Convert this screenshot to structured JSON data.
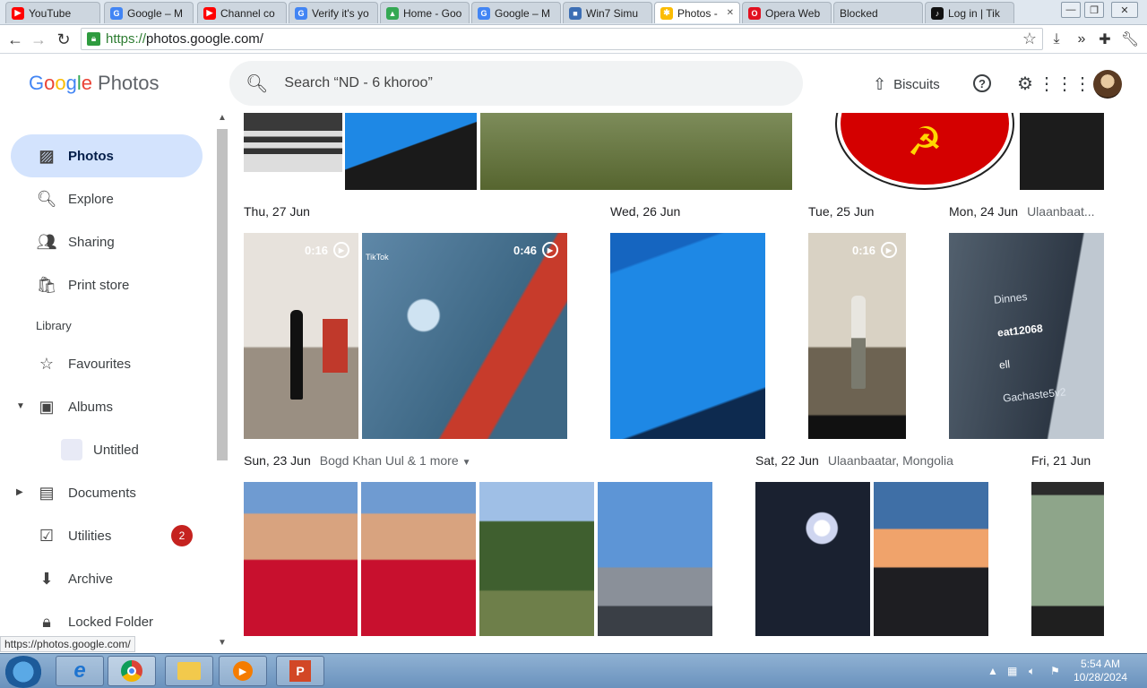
{
  "browser": {
    "tabs": [
      {
        "title": "YouTube",
        "icon_color": "#ff0000",
        "icon": "▶"
      },
      {
        "title": "Google – M",
        "icon_color": "#4285f4",
        "icon": "G"
      },
      {
        "title": "Channel co",
        "icon_color": "#ff0000",
        "icon": "▶"
      },
      {
        "title": "Verify it's yo",
        "icon_color": "#4285f4",
        "icon": "G"
      },
      {
        "title": "Home - Goo",
        "icon_color": "#34a853",
        "icon": "▲"
      },
      {
        "title": "Google – M",
        "icon_color": "#4285f4",
        "icon": "G"
      },
      {
        "title": "Win7 Simu",
        "icon_color": "#3c6eb4",
        "icon": "■"
      },
      {
        "title": "Photos - ",
        "icon_color": "#fbbc04",
        "icon": "✱"
      },
      {
        "title": "Opera Web",
        "icon_color": "#e21020",
        "icon": "O"
      },
      {
        "title": "Blocked",
        "icon_color": "#dfe7ef",
        "icon": ""
      },
      {
        "title": "Log in | Tik",
        "icon_color": "#111111",
        "icon": "♪"
      }
    ],
    "url_scheme": "https://",
    "url_host": "photos.google.com/",
    "status_url": "https://photos.google.com/"
  },
  "app": {
    "logo_text": "Photos",
    "search_placeholder": "Search “ND - 6 khoroo”",
    "upload_label": "Biscuits",
    "nav": {
      "photos": "Photos",
      "explore": "Explore",
      "sharing": "Sharing",
      "print_store": "Print store",
      "library_heading": "Library",
      "favourites": "Favourites",
      "albums": "Albums",
      "untitled": "Untitled",
      "documents": "Documents",
      "utilities": "Utilities",
      "utilities_badge": "2",
      "archive": "Archive",
      "locked_folder": "Locked Folder"
    },
    "dates": {
      "d27": "Thu, 27 Jun",
      "d26": "Wed, 26 Jun",
      "d25": "Tue, 25 Jun",
      "d24": "Mon, 24 Jun",
      "d24_loc": "Ulaanbaat...",
      "d23": "Sun, 23 Jun",
      "d23_loc": "Bogd Khan Uul & 1 more",
      "d22": "Sat, 22 Jun",
      "d22_loc": "Ulaanbaatar, Mongolia",
      "d21": "Fri, 21 Jun"
    },
    "videos": {
      "v1": "0:16",
      "v2": "0:46",
      "v3": "0:16"
    },
    "photo_text": {
      "tiktok": "TikTok",
      "menu_1": "Dinnes",
      "menu_2": "eat12068",
      "menu_3": "ell",
      "menu_4": "Gachaste5v2"
    }
  },
  "taskbar": {
    "time": "5:54 AM",
    "date": "10/28/2024"
  }
}
